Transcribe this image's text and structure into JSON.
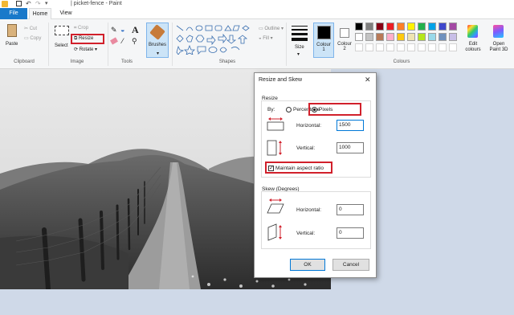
{
  "window": {
    "title": "| picket-fence - Paint"
  },
  "tabs": {
    "file": "File",
    "home": "Home",
    "view": "View"
  },
  "clipboard": {
    "paste": "Paste",
    "cut": "Cut",
    "copy": "Copy",
    "group": "Clipboard"
  },
  "image": {
    "select": "Select",
    "crop": "Crop",
    "resize": "Resize",
    "rotate": "Rotate",
    "group": "Image"
  },
  "tools": {
    "group": "Tools"
  },
  "brushes": {
    "label": "Brushes"
  },
  "shapes": {
    "outline": "Outline",
    "fill": "Fill",
    "group": "Shapes"
  },
  "size": {
    "label": "Size"
  },
  "colours": {
    "colour1": "Colour\n1",
    "colour2": "Colour\n2",
    "edit": "Edit colours",
    "paint3d": "Open Paint 3D",
    "group": "Colours",
    "row1": [
      "#000000",
      "#7f7f7f",
      "#880015",
      "#ed1c24",
      "#ff7f27",
      "#fff200",
      "#22b14c",
      "#00a2e8",
      "#3f48cc",
      "#a349a4"
    ],
    "row2": [
      "#ffffff",
      "#c3c3c3",
      "#b97a57",
      "#ffaec9",
      "#ffc90e",
      "#efe4b0",
      "#b5e61d",
      "#99d9ea",
      "#7092be",
      "#c8bfe7"
    ]
  },
  "dialog": {
    "title": "Resize and Skew",
    "resize_section": "Resize",
    "by": "By:",
    "percentage": "Percentage",
    "pixels": "Pixels",
    "horizontal": "Horizontal:",
    "vertical": "Vertical:",
    "horizontal_value": "1500",
    "vertical_value": "1000",
    "maintain": "Maintain aspect ratio",
    "skew_section": "Skew (Degrees)",
    "skew_horizontal_value": "0",
    "skew_vertical_value": "0",
    "ok": "OK",
    "cancel": "Cancel"
  }
}
